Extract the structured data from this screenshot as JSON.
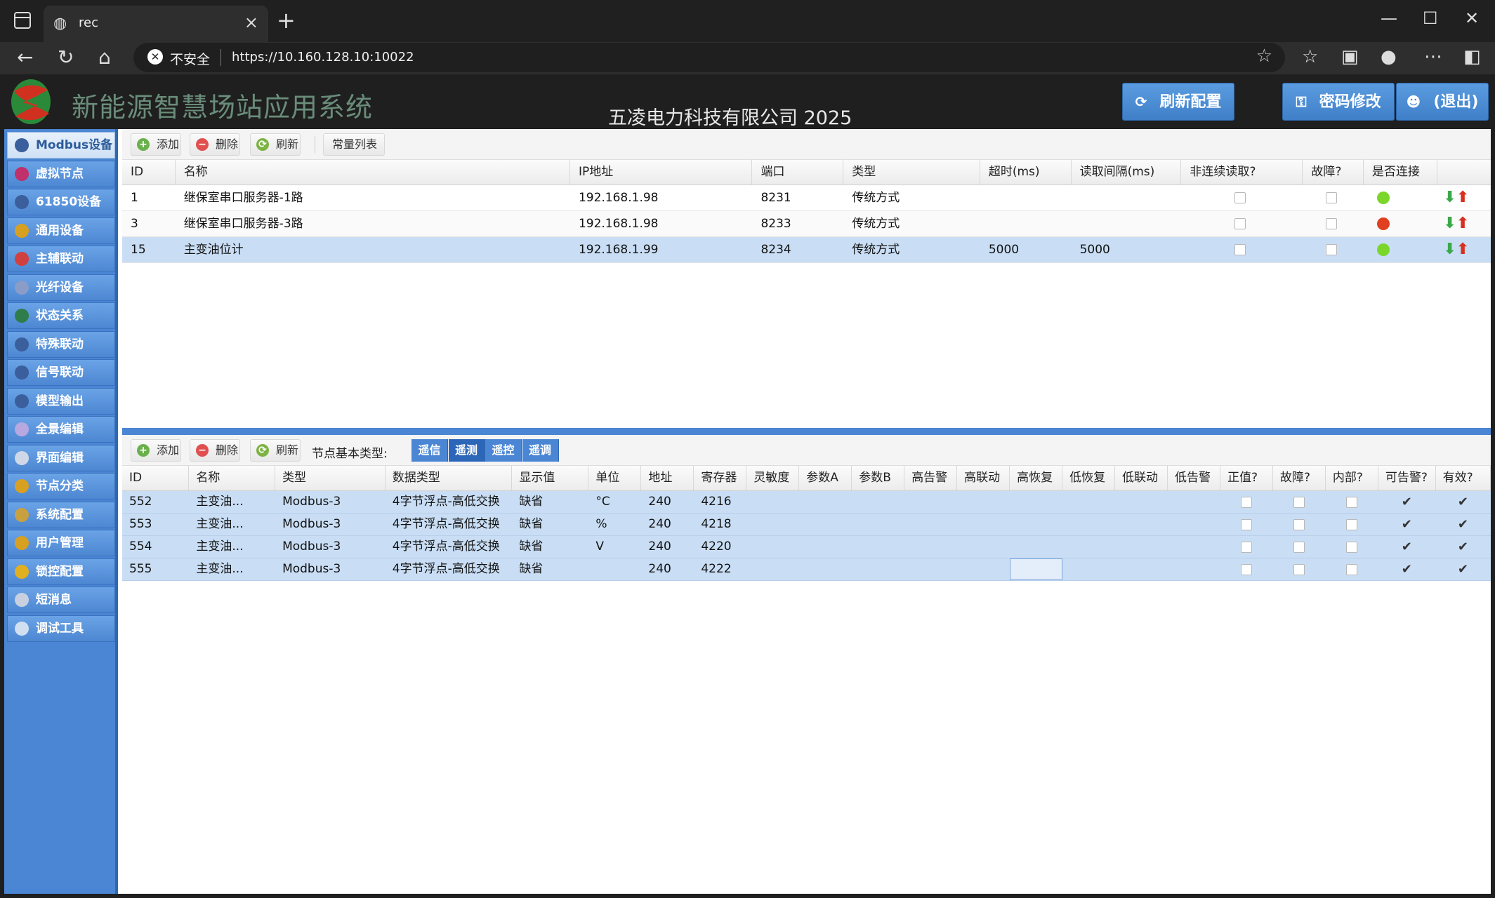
{
  "browser": {
    "tab_title": "rec",
    "insecure_label": "不安全",
    "url": "https://10.160.128.10:10022"
  },
  "header": {
    "app_title": "新能源智慧场站应用系统",
    "company": "五凌电力科技有限公司 2025",
    "refresh_config": "刷新配置",
    "change_password": "密码修改",
    "logout": "(退出)"
  },
  "sidebar": {
    "items": [
      {
        "label": "Modbus设备",
        "icon": "modbus-icon",
        "color": "#3a5f9c"
      },
      {
        "label": "虚拟节点",
        "icon": "virtual-node-icon",
        "color": "#c0306a"
      },
      {
        "label": "61850设备",
        "icon": "iec61850-icon",
        "color": "#3a5f9c"
      },
      {
        "label": "通用设备",
        "icon": "general-device-icon",
        "color": "#d8a020"
      },
      {
        "label": "主辅联动",
        "icon": "warning-icon",
        "color": "#d04040"
      },
      {
        "label": "光纤设备",
        "icon": "fiber-icon",
        "color": "#8a9cc8"
      },
      {
        "label": "状态关系",
        "icon": "status-icon",
        "color": "#2e7d4a"
      },
      {
        "label": "特殊联动",
        "icon": "special-link-icon",
        "color": "#3a5f9c"
      },
      {
        "label": "信号联动",
        "icon": "signal-link-icon",
        "color": "#3a5f9c"
      },
      {
        "label": "模型输出",
        "icon": "model-output-icon",
        "color": "#3a5f9c"
      },
      {
        "label": "全景编辑",
        "icon": "panorama-icon",
        "color": "#b8a8e0"
      },
      {
        "label": "界面编辑",
        "icon": "list-icon",
        "color": "#d0d8e8"
      },
      {
        "label": "节点分类",
        "icon": "category-icon",
        "color": "#d8a020"
      },
      {
        "label": "系统配置",
        "icon": "system-config-icon",
        "color": "#c8a040"
      },
      {
        "label": "用户管理",
        "icon": "user-icon",
        "color": "#d8a020"
      },
      {
        "label": "锁控配置",
        "icon": "lock-icon",
        "color": "#e0b020"
      },
      {
        "label": "短消息",
        "icon": "message-icon",
        "color": "#c8d0e0"
      },
      {
        "label": "调试工具",
        "icon": "gear-icon",
        "color": "#d0e0f0"
      }
    ]
  },
  "top_toolbar": {
    "add": "添加",
    "delete": "删除",
    "refresh": "刷新",
    "constants": "常量列表"
  },
  "device_table": {
    "columns": [
      "ID",
      "名称",
      "IP地址",
      "端口",
      "类型",
      "超时(ms)",
      "读取间隔(ms)",
      "非连续读取?",
      "故障?",
      "是否连接"
    ],
    "rows": [
      {
        "id": "1",
        "name": "继保室串口服务器-1路",
        "ip": "192.168.1.98",
        "port": "8231",
        "type": "传统方式",
        "timeout": "",
        "interval": "",
        "noncontinuous": false,
        "fault": false,
        "connected": "#7ad62a"
      },
      {
        "id": "3",
        "name": "继保室串口服务器-3路",
        "ip": "192.168.1.98",
        "port": "8233",
        "type": "传统方式",
        "timeout": "",
        "interval": "",
        "noncontinuous": false,
        "fault": false,
        "connected": "#e04020"
      },
      {
        "id": "15",
        "name": "主变油位计",
        "ip": "192.168.1.99",
        "port": "8234",
        "type": "传统方式",
        "timeout": "5000",
        "interval": "5000",
        "noncontinuous": false,
        "fault": false,
        "connected": "#7ad62a"
      }
    ]
  },
  "bottom_toolbar": {
    "add": "添加",
    "delete": "删除",
    "refresh": "刷新",
    "node_type_label": "节点基本类型:",
    "type_tabs": [
      "遥信",
      "遥测",
      "遥控",
      "遥调"
    ],
    "active_tab": "遥测"
  },
  "node_table": {
    "columns": [
      "ID",
      "名称",
      "类型",
      "数据类型",
      "显示值",
      "单位",
      "地址",
      "寄存器",
      "灵敏度",
      "参数A",
      "参数B",
      "高告警",
      "高联动",
      "高恢复",
      "低恢复",
      "低联动",
      "低告警",
      "正值?",
      "故障?",
      "内部?",
      "可告警?",
      "有效?"
    ],
    "rows": [
      {
        "id": "552",
        "name": "主变油...",
        "type": "Modbus-3",
        "data_type": "4字节浮点-高低交换",
        "display": "缺省",
        "unit": "°C",
        "address": "240",
        "register": "4216",
        "positive": false,
        "fault": false,
        "internal": false,
        "alarmable": true,
        "valid": true
      },
      {
        "id": "553",
        "name": "主变油...",
        "type": "Modbus-3",
        "data_type": "4字节浮点-高低交换",
        "display": "缺省",
        "unit": "%",
        "address": "240",
        "register": "4218",
        "positive": false,
        "fault": false,
        "internal": false,
        "alarmable": true,
        "valid": true
      },
      {
        "id": "554",
        "name": "主变油...",
        "type": "Modbus-3",
        "data_type": "4字节浮点-高低交换",
        "display": "缺省",
        "unit": "V",
        "address": "240",
        "register": "4220",
        "positive": false,
        "fault": false,
        "internal": false,
        "alarmable": true,
        "valid": true
      },
      {
        "id": "555",
        "name": "主变油...",
        "type": "Modbus-3",
        "data_type": "4字节浮点-高低交换",
        "display": "缺省",
        "unit": "",
        "address": "240",
        "register": "4222",
        "positive": false,
        "fault": false,
        "internal": false,
        "alarmable": true,
        "valid": true
      }
    ]
  }
}
